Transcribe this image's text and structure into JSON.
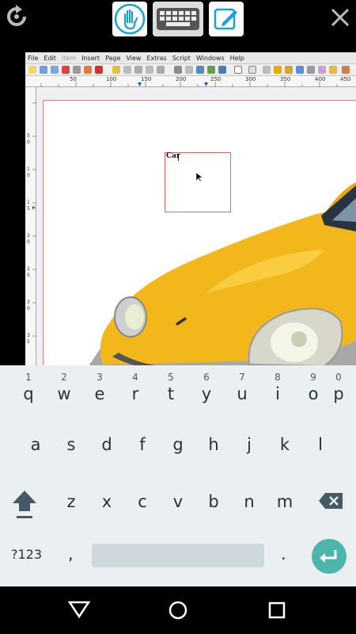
{
  "top_bar": {
    "icons": [
      "refresh-icon",
      "hand-icon",
      "keyboard-icon",
      "edit-icon",
      "close-icon"
    ],
    "accent_color": "#1aa0d8"
  },
  "app": {
    "menu": [
      "File",
      "Edit",
      "Item",
      "Insert",
      "Page",
      "View",
      "Extras",
      "Script",
      "Windows",
      "Help"
    ],
    "ruler_ticks_h": [
      "50",
      "100",
      "150",
      "200",
      "250",
      "300",
      "350",
      "400",
      "450"
    ],
    "ruler_ticks_v": [
      "5",
      "0",
      "1",
      "0",
      "1",
      "5",
      "2",
      "0",
      "2",
      "5",
      "3",
      "0",
      "3",
      "5"
    ],
    "text_frame_content": "Car"
  },
  "keyboard": {
    "number_hints": [
      "1",
      "2",
      "3",
      "4",
      "5",
      "6",
      "7",
      "8",
      "9",
      "0"
    ],
    "row1": [
      "q",
      "w",
      "e",
      "r",
      "t",
      "y",
      "u",
      "i",
      "o",
      "p"
    ],
    "row2": [
      "a",
      "s",
      "d",
      "f",
      "g",
      "h",
      "j",
      "k",
      "l"
    ],
    "row3": [
      "z",
      "x",
      "c",
      "v",
      "b",
      "n",
      "m"
    ],
    "symbols_label": "?123",
    "comma": ",",
    "period": ".",
    "enter_color": "#4db6ac"
  },
  "nav_bar": {
    "icons": [
      "back-icon",
      "home-icon",
      "recents-icon"
    ]
  }
}
